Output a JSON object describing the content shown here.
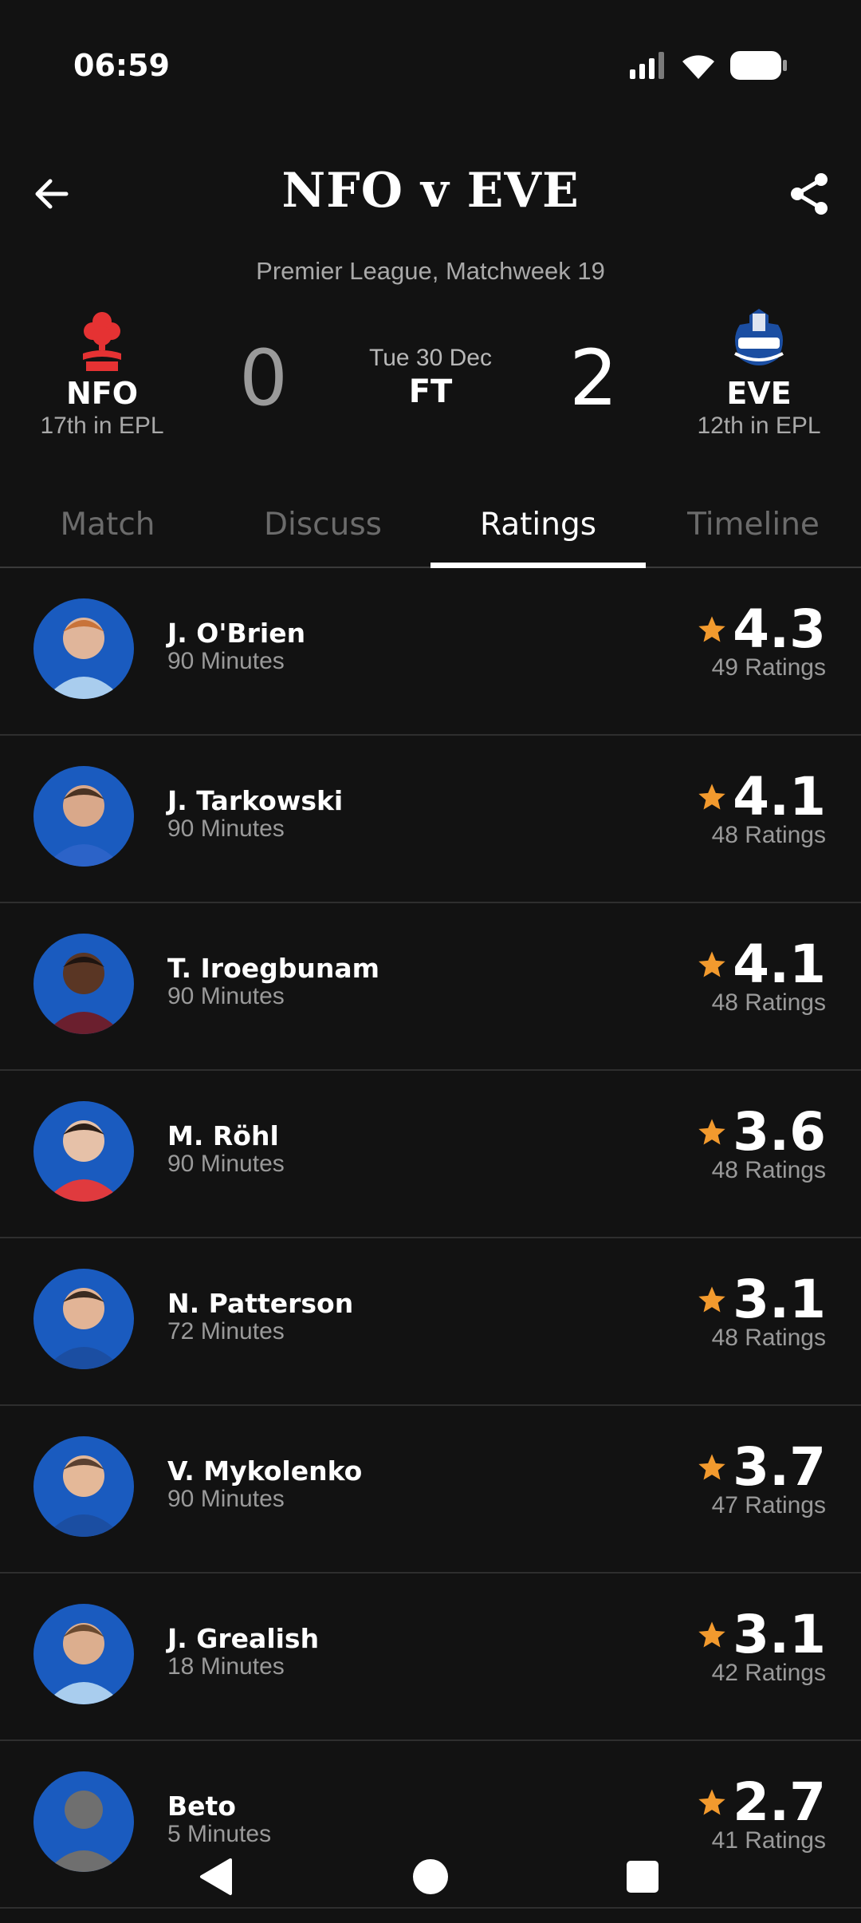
{
  "status_bar": {
    "time": "06:59"
  },
  "header": {
    "title": "NFO v EVE"
  },
  "match": {
    "competition": "Premier League, Matchweek 19",
    "date": "Tue 30 Dec",
    "status": "FT",
    "home": {
      "abbr": "NFO",
      "position": "17th in EPL",
      "score": "0",
      "crest_icon": "nottingham-forest-crest-icon"
    },
    "away": {
      "abbr": "EVE",
      "position": "12th in EPL",
      "score": "2",
      "crest_icon": "everton-crest-icon"
    }
  },
  "tabs": [
    {
      "label": "Match"
    },
    {
      "label": "Discuss"
    },
    {
      "label": "Ratings",
      "active": true
    },
    {
      "label": "Timeline"
    }
  ],
  "players": [
    {
      "name": "J. O'Brien",
      "minutes": "90 Minutes",
      "rating": "4.3",
      "count": "49 Ratings"
    },
    {
      "name": "J. Tarkowski",
      "minutes": "90 Minutes",
      "rating": "4.1",
      "count": "48 Ratings"
    },
    {
      "name": "T. Iroegbunam",
      "minutes": "90 Minutes",
      "rating": "4.1",
      "count": "48 Ratings"
    },
    {
      "name": "M. Röhl",
      "minutes": "90 Minutes",
      "rating": "3.6",
      "count": "48 Ratings"
    },
    {
      "name": "N. Patterson",
      "minutes": "72 Minutes",
      "rating": "3.1",
      "count": "48 Ratings"
    },
    {
      "name": "V. Mykolenko",
      "minutes": "90 Minutes",
      "rating": "3.7",
      "count": "47 Ratings"
    },
    {
      "name": "J. Grealish",
      "minutes": "18 Minutes",
      "rating": "3.1",
      "count": "42 Ratings"
    },
    {
      "name": "Beto",
      "minutes": "5 Minutes",
      "rating": "2.7",
      "count": "41 Ratings"
    }
  ],
  "colors": {
    "background": "#121212",
    "star": "#f29a2e",
    "avatar_bg": "#1a5bbf",
    "forest_red": "#e53233",
    "everton_blue": "#1b4ea2"
  }
}
